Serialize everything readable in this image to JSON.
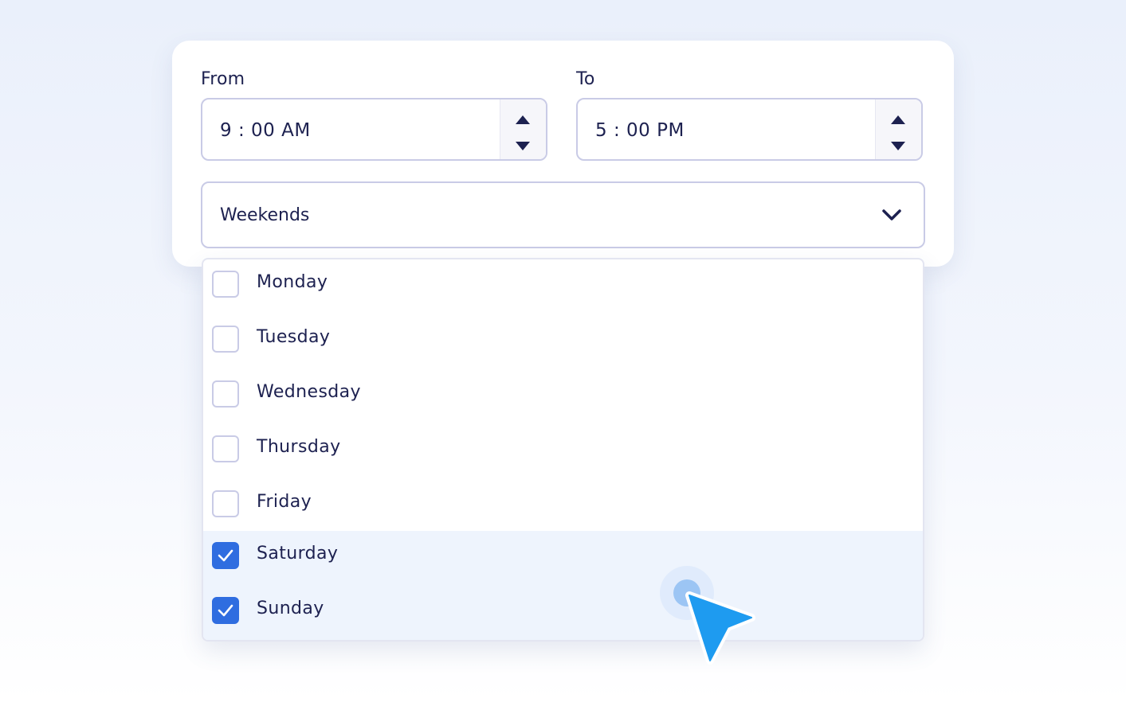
{
  "colors": {
    "text": "#1d2150",
    "border": "#c9cbe6",
    "accent": "#2f6de0",
    "selected_row": "#eef4fd",
    "cursor": "#1e9bf0"
  },
  "from": {
    "label": "From",
    "value": "9 : 00 AM"
  },
  "to": {
    "label": "To",
    "value": "5 : 00 PM"
  },
  "preset_select": {
    "value": "Weekends",
    "icon": "chevron-down-icon"
  },
  "days": [
    {
      "label": "Monday",
      "checked": false
    },
    {
      "label": "Tuesday",
      "checked": false
    },
    {
      "label": "Wednesday",
      "checked": false
    },
    {
      "label": "Thursday",
      "checked": false
    },
    {
      "label": "Friday",
      "checked": false
    },
    {
      "label": "Saturday",
      "checked": true
    },
    {
      "label": "Sunday",
      "checked": true
    }
  ]
}
